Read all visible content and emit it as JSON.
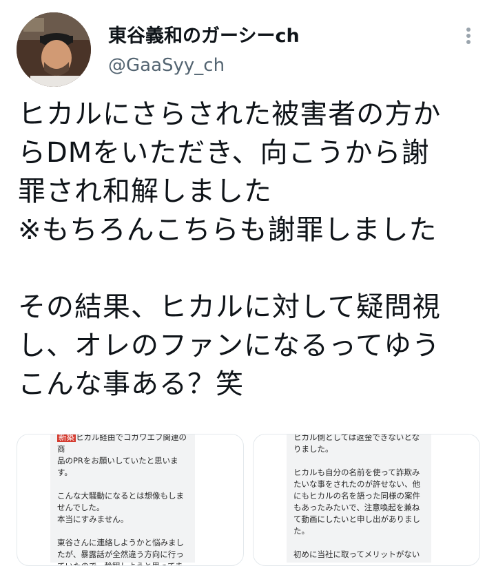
{
  "tweet": {
    "author_name": "東谷義和のガーシーch",
    "handle": "@GaaSyy_ch",
    "text": "ヒカルにさらされた被害者の方か\nらDMをいただき、向こうから謝\n罪され和解しました\n※もちろんこちらも謝罪しました\n\nその結果、ヒカルに対して疑問視\nし、オレのファンになるってゆう\nこんな事ある？笑"
  },
  "media": [
    {
      "badge": "新築",
      "text": "ヒカル経由でコガワエフ関連の商\n品のPRをお願いしていたと思いま\nす。\n\nこんな大騒動になるとは想像もしま\nせんでした。\n本当にすみません。\n\n東谷さんに連絡しようかと悩みまし\nたが、暴露話が全然違う方向に行っ\nていたので、静観しようと思ってま\nしたが、ガーシー本当に東谷さんのに"
    },
    {
      "text": "ヒカル側としては返金できないとな\nりました。\n\nヒカルも自分の名前を使って詐欺み\nたいな事をされたのが許せない、他\nにもヒカルの名を語った同様の案件\nもあったみたいで、注意喚起を兼ね\nて動画にしたいと申し出がありまし\nた。\n\n初めに当社に取ってメリットがない"
    }
  ],
  "icons": {
    "more": "more-vertical-icon"
  }
}
